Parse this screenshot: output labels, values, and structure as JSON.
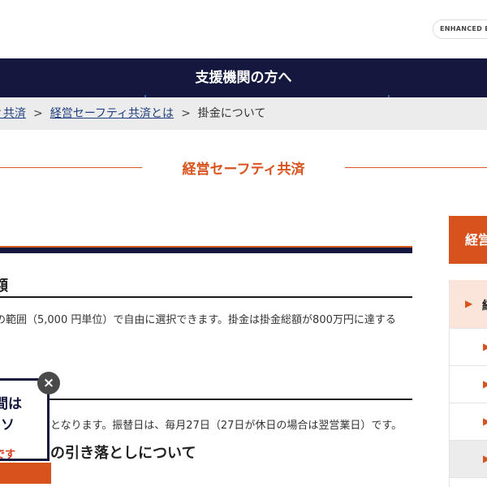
{
  "badge": {
    "label": "ENHANCED BY"
  },
  "nav": {
    "title": "支援機関の方へ"
  },
  "breadcrumb": {
    "items": [
      {
        "label": "ィ共済"
      },
      {
        "label": "経営セーフティ共済とは"
      }
    ],
    "separator": ">",
    "current": "掛金について"
  },
  "section": {
    "title": "経営セーフティ共済"
  },
  "content": {
    "heading_amount": "額",
    "paragraph_amount": "の範囲（5,000 円単位）で自由に選択できます。掛金は掛金総額が800万円に達する",
    "paragraph_transfer": "となります。振替日は、毎月27日（27日が休日の場合は翌営業日）です。",
    "heading_debit": "の引き落としについて"
  },
  "popup": {
    "line1": "間は",
    "line2": "ソ",
    "line3": "です",
    "close_label": "×"
  },
  "sidebar": {
    "heading": "経営",
    "active_label": "経",
    "arrow": "▶"
  },
  "colors": {
    "navy": "#14183f",
    "orange": "#d7521d",
    "link": "#1f3f80",
    "active_bg": "#fbe5da"
  }
}
